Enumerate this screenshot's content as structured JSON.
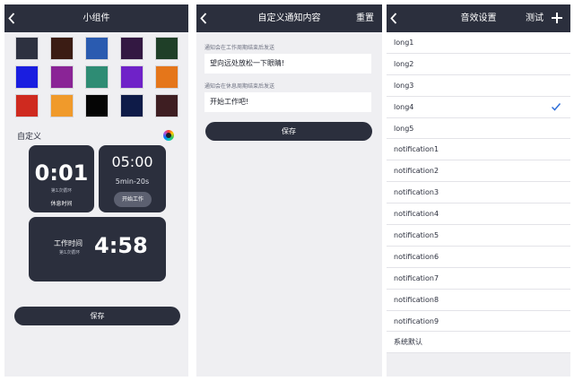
{
  "widget": {
    "title": "小组件",
    "swatches": [
      "#2d3140",
      "#3b1c14",
      "#2a5bb0",
      "#331842",
      "#1f3f28",
      "#1a1ee0",
      "#8a2496",
      "#2e8c74",
      "#6f22c8",
      "#e5761a",
      "#cf2a1f",
      "#f09a2b",
      "#050505",
      "#0e1b48",
      "#3e1e22"
    ],
    "custom_label": "自定义",
    "card_rest": {
      "time": "0:01",
      "sub": "第1次循环",
      "label": "休息时间"
    },
    "card_range": {
      "time": "05:00",
      "range": "5min-20s",
      "button": "开始工作"
    },
    "card_work": {
      "label": "工作时间",
      "sub": "第1次循环",
      "time": "4:58"
    },
    "save_label": "保存"
  },
  "notify": {
    "title": "自定义通知内容",
    "reset": "重置",
    "work_hint": "通知会在工作周期结束后发送",
    "work_text": "望向远处放松一下眼睛!",
    "rest_hint": "通知会在休息周期结束后发送",
    "rest_text": "开始工作吧!",
    "save_label": "保存"
  },
  "sound": {
    "title": "音效设置",
    "test": "测试",
    "selected": "long4",
    "accent": "#2f6fd8",
    "items": [
      "long1",
      "long2",
      "long3",
      "long4",
      "long5",
      "notification1",
      "notification2",
      "notification3",
      "notification4",
      "notification5",
      "notification6",
      "notification7",
      "notification8",
      "notification9",
      "系统默认"
    ]
  }
}
